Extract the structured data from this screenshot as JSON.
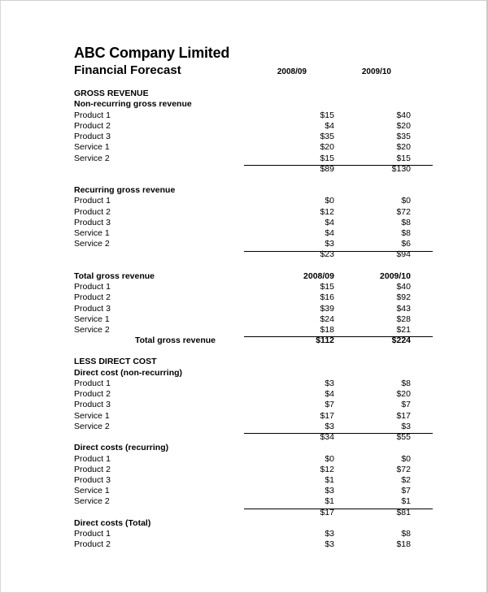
{
  "title": "ABC Company Limited",
  "subtitle": "Financial Forecast",
  "years": [
    "2008/09",
    "2009/10"
  ],
  "gross_revenue": {
    "heading": "GROSS REVENUE",
    "non_recurring": {
      "label": "Non-recurring gross revenue",
      "rows": [
        {
          "label": "Product 1",
          "y1": "$15",
          "y2": "$40"
        },
        {
          "label": "Product 2",
          "y1": "$4",
          "y2": "$20"
        },
        {
          "label": "Product 3",
          "y1": "$35",
          "y2": "$35"
        },
        {
          "label": "Service 1",
          "y1": "$20",
          "y2": "$20"
        },
        {
          "label": "Service 2",
          "y1": "$15",
          "y2": "$15"
        }
      ],
      "total": {
        "y1": "$89",
        "y2": "$130"
      }
    },
    "recurring": {
      "label": "Recurring gross revenue",
      "rows": [
        {
          "label": "Product 1",
          "y1": "$0",
          "y2": "$0"
        },
        {
          "label": "Product 2",
          "y1": "$12",
          "y2": "$72"
        },
        {
          "label": "Product 3",
          "y1": "$4",
          "y2": "$8"
        },
        {
          "label": "Service 1",
          "y1": "$4",
          "y2": "$8"
        },
        {
          "label": "Service 2",
          "y1": "$3",
          "y2": "$6"
        }
      ],
      "total": {
        "y1": "$23",
        "y2": "$94"
      }
    },
    "total": {
      "label": "Total gross revenue",
      "years": [
        "2008/09",
        "2009/10"
      ],
      "rows": [
        {
          "label": "Product 1",
          "y1": "$15",
          "y2": "$40"
        },
        {
          "label": "Product 2",
          "y1": "$16",
          "y2": "$92"
        },
        {
          "label": "Product 3",
          "y1": "$39",
          "y2": "$43"
        },
        {
          "label": "Service 1",
          "y1": "$24",
          "y2": "$28"
        },
        {
          "label": "Service 2",
          "y1": "$18",
          "y2": "$21"
        }
      ],
      "total": {
        "label": "Total gross revenue",
        "y1": "$112",
        "y2": "$224"
      }
    }
  },
  "direct_cost": {
    "heading": "LESS DIRECT COST",
    "non_recurring": {
      "label": "Direct cost (non-recurring)",
      "rows": [
        {
          "label": "Product 1",
          "y1": "$3",
          "y2": "$8"
        },
        {
          "label": "Product 2",
          "y1": "$4",
          "y2": "$20"
        },
        {
          "label": "Product 3",
          "y1": "$7",
          "y2": "$7"
        },
        {
          "label": "Service 1",
          "y1": "$17",
          "y2": "$17"
        },
        {
          "label": "Service 2",
          "y1": "$3",
          "y2": "$3"
        }
      ],
      "total": {
        "y1": "$34",
        "y2": "$55"
      }
    },
    "recurring": {
      "label": "Direct costs (recurring)",
      "rows": [
        {
          "label": "Product 1",
          "y1": "$0",
          "y2": "$0"
        },
        {
          "label": "Product 2",
          "y1": "$12",
          "y2": "$72"
        },
        {
          "label": "Product 3",
          "y1": "$1",
          "y2": "$2"
        },
        {
          "label": "Service 1",
          "y1": "$3",
          "y2": "$7"
        },
        {
          "label": "Service 2",
          "y1": "$1",
          "y2": "$1"
        }
      ],
      "total": {
        "y1": "$17",
        "y2": "$81"
      }
    },
    "total": {
      "label": "Direct costs (Total)",
      "rows": [
        {
          "label": "Product 1",
          "y1": "$3",
          "y2": "$8"
        },
        {
          "label": "Product 2",
          "y1": "$3",
          "y2": "$18"
        }
      ]
    }
  }
}
